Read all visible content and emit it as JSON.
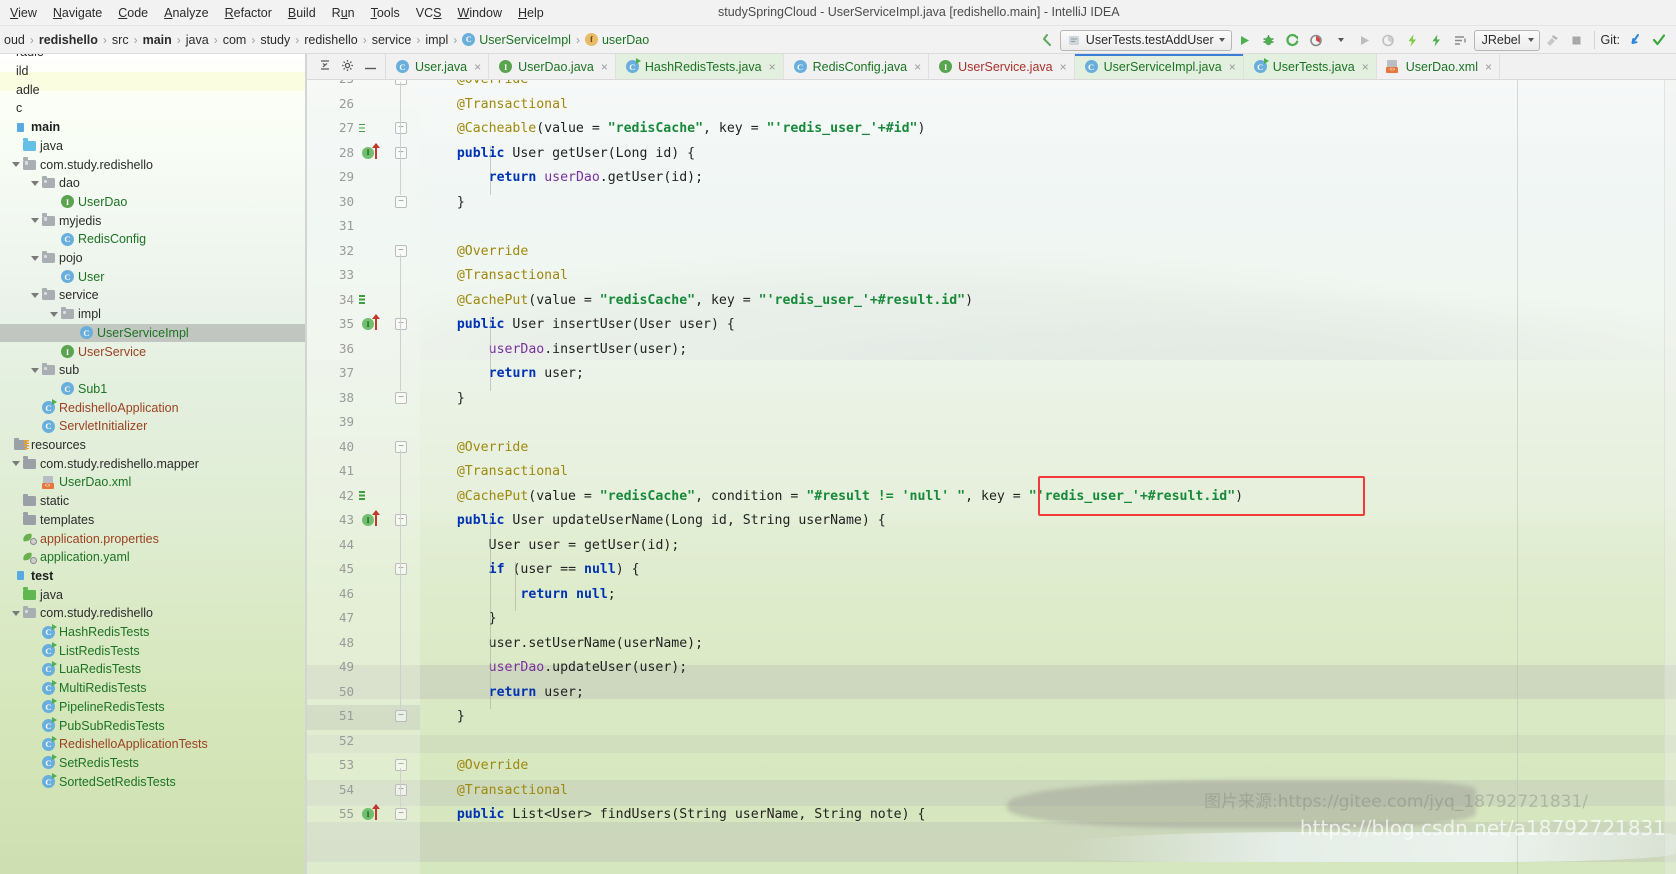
{
  "window": {
    "title": "studySpringCloud - UserServiceImpl.java [redishello.main] - IntelliJ IDEA"
  },
  "menubar": {
    "items": [
      {
        "label": "View",
        "mnemonic": "V"
      },
      {
        "label": "Navigate",
        "mnemonic": "N"
      },
      {
        "label": "Code",
        "mnemonic": "C"
      },
      {
        "label": "Analyze",
        "mnemonic": "A"
      },
      {
        "label": "Refactor",
        "mnemonic": "R"
      },
      {
        "label": "Build",
        "mnemonic": "B"
      },
      {
        "label": "Run",
        "mnemonic": "u"
      },
      {
        "label": "Tools",
        "mnemonic": "T"
      },
      {
        "label": "VCS",
        "mnemonic": "S"
      },
      {
        "label": "Window",
        "mnemonic": "W"
      },
      {
        "label": "Help",
        "mnemonic": "H"
      }
    ]
  },
  "breadcrumb": {
    "items": [
      {
        "label": "oud",
        "style": "normal",
        "icon": ""
      },
      {
        "label": "redishello",
        "style": "bold",
        "icon": ""
      },
      {
        "label": "src",
        "style": "normal",
        "icon": ""
      },
      {
        "label": "main",
        "style": "bold",
        "icon": ""
      },
      {
        "label": "java",
        "style": "normal",
        "icon": ""
      },
      {
        "label": "com",
        "style": "normal",
        "icon": ""
      },
      {
        "label": "study",
        "style": "normal",
        "icon": ""
      },
      {
        "label": "redishello",
        "style": "normal",
        "icon": ""
      },
      {
        "label": "service",
        "style": "normal",
        "icon": ""
      },
      {
        "label": "impl",
        "style": "normal",
        "icon": ""
      },
      {
        "label": "UserServiceImpl",
        "style": "green",
        "icon": "class-icon"
      },
      {
        "label": "userDao",
        "style": "green",
        "icon": "field-icon"
      }
    ],
    "separator": "›"
  },
  "toolbar": {
    "back_arrow": "back-arrow-icon",
    "run_config": "UserTests.testAddUser",
    "run_button": "run-icon",
    "debug_button": "debug-icon",
    "run_coverage_button": "run-with-coverage-icon",
    "profile_button": "profiler-icon",
    "rerun_button": "rerun-icon",
    "attach_button": "attach-icon",
    "hotswap_button": "jrebel-run-icon",
    "hotswap_debug_button": "jrebel-debug-icon",
    "flow_button": "flow-icon",
    "jrebel_label": "JRebel",
    "stop_button": "stop-icon",
    "hammer_button": "hammer-icon",
    "git_label": "Git:",
    "git_update_button": "update-project-icon",
    "git_commit_button": "commit-icon"
  },
  "project_panel": {
    "header_icons": [
      "collapse-all-icon",
      "settings-gear-icon",
      "hide-icon"
    ],
    "rows": [
      {
        "label": "radle",
        "indent": 0,
        "kind": "clipped-top",
        "color": "normal",
        "chevron": false,
        "icon": "none"
      },
      {
        "label": "ild",
        "indent": 0,
        "kind": "clipped",
        "color": "normal",
        "chevron": false,
        "icon": "none"
      },
      {
        "label": "adle",
        "indent": 0,
        "kind": "clipped",
        "color": "normal",
        "chevron": false,
        "icon": "none"
      },
      {
        "label": "c",
        "indent": 0,
        "kind": "clipped",
        "color": "normal",
        "chevron": false,
        "icon": "none"
      },
      {
        "label": "main",
        "indent": 0,
        "kind": "module",
        "color": "bold",
        "chevron": false,
        "icon": "module-icon"
      },
      {
        "label": "java",
        "indent": 1,
        "kind": "folder",
        "color": "normal",
        "chevron": false,
        "icon": "source-folder-blue-icon"
      },
      {
        "label": "com.study.redishello",
        "indent": 1,
        "kind": "package",
        "color": "normal",
        "chevron": true,
        "icon": "package-icon"
      },
      {
        "label": "dao",
        "indent": 2,
        "kind": "package",
        "color": "normal",
        "chevron": true,
        "icon": "package-icon"
      },
      {
        "label": "UserDao",
        "indent": 3,
        "kind": "interface",
        "color": "green",
        "chevron": false,
        "icon": "interface-icon"
      },
      {
        "label": "myjedis",
        "indent": 2,
        "kind": "package",
        "color": "normal",
        "chevron": true,
        "icon": "package-icon"
      },
      {
        "label": "RedisConfig",
        "indent": 3,
        "kind": "class",
        "color": "green",
        "chevron": false,
        "icon": "class-icon"
      },
      {
        "label": "pojo",
        "indent": 2,
        "kind": "package",
        "color": "normal",
        "chevron": true,
        "icon": "package-icon"
      },
      {
        "label": "User",
        "indent": 3,
        "kind": "class",
        "color": "green",
        "chevron": false,
        "icon": "class-icon"
      },
      {
        "label": "service",
        "indent": 2,
        "kind": "package",
        "color": "normal",
        "chevron": true,
        "icon": "package-icon"
      },
      {
        "label": "impl",
        "indent": 3,
        "kind": "package",
        "color": "normal",
        "chevron": true,
        "icon": "package-icon"
      },
      {
        "label": "UserServiceImpl",
        "indent": 4,
        "kind": "class",
        "color": "green",
        "chevron": false,
        "icon": "class-icon",
        "selected": true
      },
      {
        "label": "UserService",
        "indent": 3,
        "kind": "interface",
        "color": "brown",
        "chevron": false,
        "icon": "interface-icon"
      },
      {
        "label": "sub",
        "indent": 2,
        "kind": "package",
        "color": "normal",
        "chevron": true,
        "icon": "package-icon"
      },
      {
        "label": "Sub1",
        "indent": 3,
        "kind": "class",
        "color": "green",
        "chevron": false,
        "icon": "class-icon"
      },
      {
        "label": "RedishelloApplication",
        "indent": 2,
        "kind": "spring-class",
        "color": "brown",
        "chevron": false,
        "icon": "spring-boot-class-icon"
      },
      {
        "label": "ServletInitializer",
        "indent": 2,
        "kind": "class",
        "color": "brown",
        "chevron": false,
        "icon": "class-icon"
      },
      {
        "label": "resources",
        "indent": 0,
        "kind": "folder",
        "color": "normal",
        "chevron": false,
        "icon": "resources-folder-icon"
      },
      {
        "label": "com.study.redishello.mapper",
        "indent": 1,
        "kind": "folder",
        "color": "normal",
        "chevron": true,
        "icon": "folder-icon"
      },
      {
        "label": "UserDao.xml",
        "indent": 2,
        "kind": "xml",
        "color": "green",
        "chevron": false,
        "icon": "xml-file-icon"
      },
      {
        "label": "static",
        "indent": 1,
        "kind": "folder",
        "color": "normal",
        "chevron": false,
        "icon": "folder-icon"
      },
      {
        "label": "templates",
        "indent": 1,
        "kind": "folder",
        "color": "normal",
        "chevron": false,
        "icon": "folder-icon"
      },
      {
        "label": "application.properties",
        "indent": 1,
        "kind": "props",
        "color": "brown",
        "chevron": false,
        "icon": "spring-properties-icon"
      },
      {
        "label": "application.yaml",
        "indent": 1,
        "kind": "props",
        "color": "green",
        "chevron": false,
        "icon": "spring-yaml-icon"
      },
      {
        "label": "test",
        "indent": 0,
        "kind": "module",
        "color": "bold",
        "chevron": false,
        "icon": "module-icon"
      },
      {
        "label": "java",
        "indent": 1,
        "kind": "folder",
        "color": "normal",
        "chevron": false,
        "icon": "test-source-folder-green-icon"
      },
      {
        "label": "com.study.redishello",
        "indent": 1,
        "kind": "package",
        "color": "normal",
        "chevron": true,
        "icon": "package-icon"
      },
      {
        "label": "HashRedisTests",
        "indent": 2,
        "kind": "test-class",
        "color": "green",
        "chevron": false,
        "icon": "runnable-class-icon"
      },
      {
        "label": "ListRedisTests",
        "indent": 2,
        "kind": "test-class",
        "color": "green",
        "chevron": false,
        "icon": "runnable-class-icon"
      },
      {
        "label": "LuaRedisTests",
        "indent": 2,
        "kind": "test-class",
        "color": "green",
        "chevron": false,
        "icon": "runnable-class-icon"
      },
      {
        "label": "MultiRedisTests",
        "indent": 2,
        "kind": "test-class",
        "color": "green",
        "chevron": false,
        "icon": "runnable-class-icon"
      },
      {
        "label": "PipelineRedisTests",
        "indent": 2,
        "kind": "test-class",
        "color": "green",
        "chevron": false,
        "icon": "runnable-class-icon"
      },
      {
        "label": "PubSubRedisTests",
        "indent": 2,
        "kind": "test-class",
        "color": "green",
        "chevron": false,
        "icon": "runnable-class-icon"
      },
      {
        "label": "RedishelloApplicationTests",
        "indent": 2,
        "kind": "test-class",
        "color": "brown",
        "chevron": false,
        "icon": "runnable-class-icon"
      },
      {
        "label": "SetRedisTests",
        "indent": 2,
        "kind": "test-class",
        "color": "green",
        "chevron": false,
        "icon": "runnable-class-icon"
      },
      {
        "label": "SortedSetRedisTests",
        "indent": 2,
        "kind": "test-class",
        "color": "green",
        "chevron": false,
        "icon": "runnable-class-icon"
      }
    ]
  },
  "editor_tabs": {
    "tools": [
      "collapse-all-icon",
      "settings-gear-icon",
      "hide-panel-icon"
    ],
    "tabs": [
      {
        "label": "User.java",
        "icon": "class-icon",
        "color": "green",
        "active": false
      },
      {
        "label": "UserDao.java",
        "icon": "interface-icon",
        "color": "green",
        "active": false
      },
      {
        "label": "HashRedisTests.java",
        "icon": "runnable-class-icon",
        "color": "green",
        "active": false,
        "highlight": true
      },
      {
        "label": "RedisConfig.java",
        "icon": "class-icon",
        "color": "green",
        "active": false
      },
      {
        "label": "UserService.java",
        "icon": "interface-icon",
        "color": "red",
        "active": false
      },
      {
        "label": "UserServiceImpl.java",
        "icon": "class-icon",
        "color": "green",
        "active": true
      },
      {
        "label": "UserTests.java",
        "icon": "runnable-class-icon",
        "color": "green",
        "active": false,
        "highlight": true
      },
      {
        "label": "UserDao.xml",
        "icon": "xml-file-icon",
        "color": "green",
        "active": false
      }
    ],
    "close_glyph": "×"
  },
  "code": {
    "first_line": 25,
    "lines": [
      {
        "n": 25,
        "text": "    @Override",
        "marker": "",
        "fold": "minus",
        "clipped": true
      },
      {
        "n": 26,
        "text": "    @Transactional",
        "marker": "",
        "fold": ""
      },
      {
        "n": 27,
        "text": "    @Cacheable(value = \"redisCache\", key = \"'redis_user_'+#id\")",
        "marker": "cache-icon",
        "fold": "minus"
      },
      {
        "n": 28,
        "text": "    public User getUser(Long id) {",
        "marker": "implements-up-icon",
        "fold": "minus"
      },
      {
        "n": 29,
        "text": "        return userDao.getUser(id);",
        "marker": "",
        "fold": ""
      },
      {
        "n": 30,
        "text": "    }",
        "marker": "",
        "fold": "minus"
      },
      {
        "n": 31,
        "text": "",
        "marker": "",
        "fold": ""
      },
      {
        "n": 32,
        "text": "    @Override",
        "marker": "",
        "fold": "minus"
      },
      {
        "n": 33,
        "text": "    @Transactional",
        "marker": "",
        "fold": ""
      },
      {
        "n": 34,
        "text": "    @CachePut(value = \"redisCache\", key = \"'redis_user_'+#result.id\")",
        "marker": "cache-icon",
        "fold": ""
      },
      {
        "n": 35,
        "text": "    public User insertUser(User user) {",
        "marker": "implements-up-icon",
        "fold": "minus"
      },
      {
        "n": 36,
        "text": "        userDao.insertUser(user);",
        "marker": "",
        "fold": ""
      },
      {
        "n": 37,
        "text": "        return user;",
        "marker": "",
        "fold": ""
      },
      {
        "n": 38,
        "text": "    }",
        "marker": "",
        "fold": "minus"
      },
      {
        "n": 39,
        "text": "",
        "marker": "",
        "fold": ""
      },
      {
        "n": 40,
        "text": "    @Override",
        "marker": "",
        "fold": "minus"
      },
      {
        "n": 41,
        "text": "    @Transactional",
        "marker": "",
        "fold": ""
      },
      {
        "n": 42,
        "text": "    @CachePut(value = \"redisCache\", condition = \"#result != 'null' \", key = \"'redis_user_'+#result.id\")",
        "marker": "cache-icon",
        "fold": ""
      },
      {
        "n": 43,
        "text": "    public User updateUserName(Long id, String userName) {",
        "marker": "implements-up-icon",
        "fold": "minus"
      },
      {
        "n": 44,
        "text": "        User user = getUser(id);",
        "marker": "",
        "fold": ""
      },
      {
        "n": 45,
        "text": "        if (user == null) {",
        "marker": "",
        "fold": "minus"
      },
      {
        "n": 46,
        "text": "            return null;",
        "marker": "",
        "fold": ""
      },
      {
        "n": 47,
        "text": "        }",
        "marker": "",
        "fold": ""
      },
      {
        "n": 48,
        "text": "        user.setUserName(userName);",
        "marker": "",
        "fold": ""
      },
      {
        "n": 49,
        "text": "        userDao.updateUser(user);",
        "marker": "",
        "fold": ""
      },
      {
        "n": 50,
        "text": "        return user;",
        "marker": "",
        "fold": ""
      },
      {
        "n": 51,
        "text": "    }",
        "marker": "",
        "fold": "minus",
        "selected": true
      },
      {
        "n": 52,
        "text": "",
        "marker": "",
        "fold": ""
      },
      {
        "n": 53,
        "text": "    @Override",
        "marker": "",
        "fold": "minus"
      },
      {
        "n": 54,
        "text": "    @Transactional",
        "marker": "",
        "fold": "minus"
      },
      {
        "n": 55,
        "text": "    public List<User> findUsers(String userName, String note) {",
        "marker": "implements-up-icon",
        "fold": "minus"
      }
    ],
    "annotation_highlight": "key = \"'redis_user_'+#result.id\")"
  },
  "watermarks": {
    "source": "图片来源:https://gitee.com/jyq_18792721831/",
    "blog": "https://blog.csdn.net/a18792721831"
  },
  "colors": {
    "keyword": "#0033b3",
    "annotation": "#9e880d",
    "string": "#178a3a",
    "field": "#7a2f9e",
    "tree_green": "#1d7324",
    "tree_brown": "#9c4221",
    "redbox": "#f23a3a",
    "tab_active_bg": "#e3efdf"
  }
}
